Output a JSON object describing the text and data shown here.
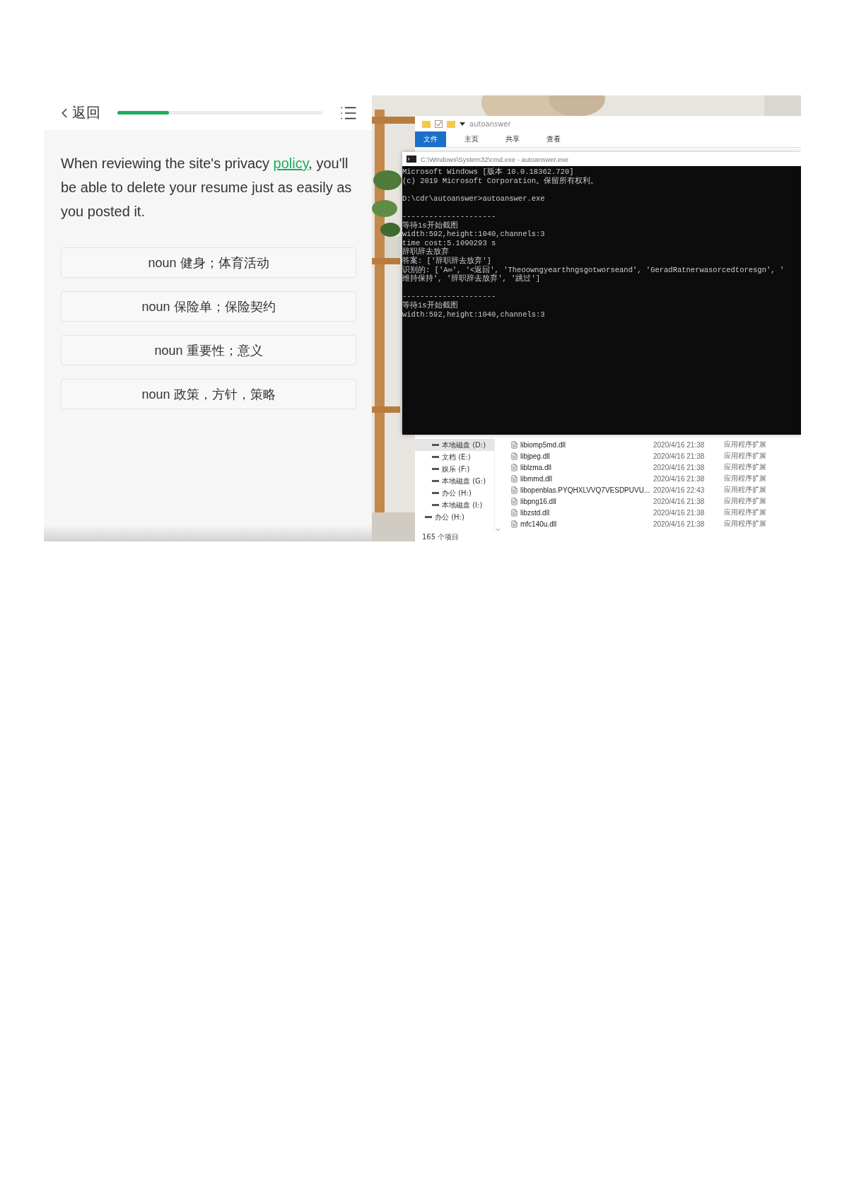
{
  "quiz": {
    "back_label": "返回",
    "progress": {
      "level": 0.25
    },
    "question": {
      "before": "When reviewing the site's privacy ",
      "link": "policy",
      "after": ", you'll be able to delete your resume just as easily as you posted it."
    },
    "options": [
      {
        "text": "noun 健身；体育活动"
      },
      {
        "text": "noun 保险单；保险契约"
      },
      {
        "text": "noun 重要性；意义"
      },
      {
        "text": "noun 政策，方针，策略"
      }
    ]
  },
  "desktop": {
    "explorer": {
      "title": "autoanswer",
      "ribbon_tabs": [
        {
          "label": "文件",
          "selected": true
        },
        {
          "label": "主页",
          "selected": false
        },
        {
          "label": "共享",
          "selected": false
        },
        {
          "label": "查看",
          "selected": false
        }
      ],
      "nav_tree": [
        {
          "children": [
            {
              "label": "本地磁盘 (D:)",
              "selected": true
            },
            {
              "label": "文档 (E:)",
              "selected": false
            },
            {
              "label": "娱乐 (F:)",
              "selected": false
            },
            {
              "label": "本地磁盘 (G:)",
              "selected": false
            },
            {
              "label": "办公 (H:)",
              "selected": false
            },
            {
              "label": "本地磁盘 (I:)",
              "selected": false
            }
          ]
        },
        {
          "label": "办公 (H:)",
          "selected": false
        }
      ],
      "files": [
        {
          "name": "libiomp5md.dll",
          "modified": "2020/4/16 21:38",
          "type": "应用程序扩展"
        },
        {
          "name": "libjpeg.dll",
          "modified": "2020/4/16 21:38",
          "type": "应用程序扩展"
        },
        {
          "name": "liblzma.dll",
          "modified": "2020/4/16 21:38",
          "type": "应用程序扩展"
        },
        {
          "name": "libmmd.dll",
          "modified": "2020/4/16 21:38",
          "type": "应用程序扩展"
        },
        {
          "name": "libopenblas.PYQHXLVVQ7VESDPUVU...",
          "modified": "2020/4/16 22:43",
          "type": "应用程序扩展"
        },
        {
          "name": "libpng16.dll",
          "modified": "2020/4/16 21:38",
          "type": "应用程序扩展"
        },
        {
          "name": "libzstd.dll",
          "modified": "2020/4/16 21:38",
          "type": "应用程序扩展"
        },
        {
          "name": "mfc140u.dll",
          "modified": "2020/4/16 21:38",
          "type": "应用程序扩展"
        }
      ],
      "status": "165 个项目"
    },
    "console": {
      "title": "C:\\Windows\\System32\\cmd.exe - autoanswer.exe",
      "blocks": [
        [
          "Microsoft Windows [版本 10.0.18362.720]",
          "(c) 2019 Microsoft Corporation。保留所有权利。"
        ],
        [
          "D:\\cdr\\autoanswer>autoanswer.exe"
        ],
        [
          "---------------------",
          "等待1s开始截图",
          "width:592,height:1040,channels:3",
          "time cost:5.1090293 s",
          "辞职辞去放弃",
          "答案: ['辞职辞去放弃']",
          "识别的: ['A∞', '<返回', 'Theoowngyearthngsgotworseand', 'GeradRatnerwasorcedtoresgn', '",
          "维持保持', '辞职辞去放弃', '跳过']"
        ],
        [
          "---------------------",
          "等待1s开始截图",
          "width:592,height:1040,channels:3"
        ]
      ]
    }
  }
}
